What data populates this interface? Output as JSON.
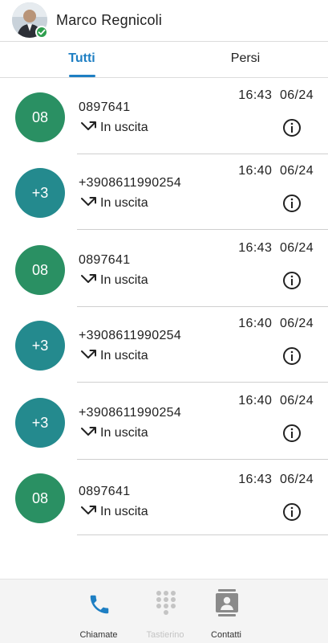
{
  "header": {
    "user_name": "Marco Regnicoli",
    "presence": "online"
  },
  "tabs": [
    {
      "label": "Tutti",
      "active": true
    },
    {
      "label": "Persi",
      "active": false
    }
  ],
  "calls": [
    {
      "avatar_text": "08",
      "number": "0897641",
      "direction": "In uscita",
      "time": "16:43  06/24",
      "color": "#2a9063"
    },
    {
      "avatar_text": "+3",
      "number": "+3908611990254",
      "direction": "In uscita",
      "time": "16:40  06/24",
      "color": "#248a8e"
    },
    {
      "avatar_text": "08",
      "number": "0897641",
      "direction": "In uscita",
      "time": "16:43  06/24",
      "color": "#2a9063"
    },
    {
      "avatar_text": "+3",
      "number": "+3908611990254",
      "direction": "In uscita",
      "time": "16:40  06/24",
      "color": "#248a8e"
    },
    {
      "avatar_text": "+3",
      "number": "+3908611990254",
      "direction": "In uscita",
      "time": "16:40  06/24",
      "color": "#248a8e"
    },
    {
      "avatar_text": "08",
      "number": "0897641",
      "direction": "In uscita",
      "time": "16:43  06/24",
      "color": "#2a9063"
    }
  ],
  "bottom_nav": [
    {
      "label": "Chiamate",
      "icon": "phone-icon",
      "state": "active"
    },
    {
      "label": "Tastierino",
      "icon": "dialpad-icon",
      "state": "disabled"
    },
    {
      "label": "Contatti",
      "icon": "contacts-icon",
      "state": "normal"
    }
  ],
  "colors": {
    "accent": "#1e7fc3",
    "presence_ok": "#2e9f4e",
    "avatar_green": "#2a9063",
    "avatar_teal": "#248a8e"
  }
}
